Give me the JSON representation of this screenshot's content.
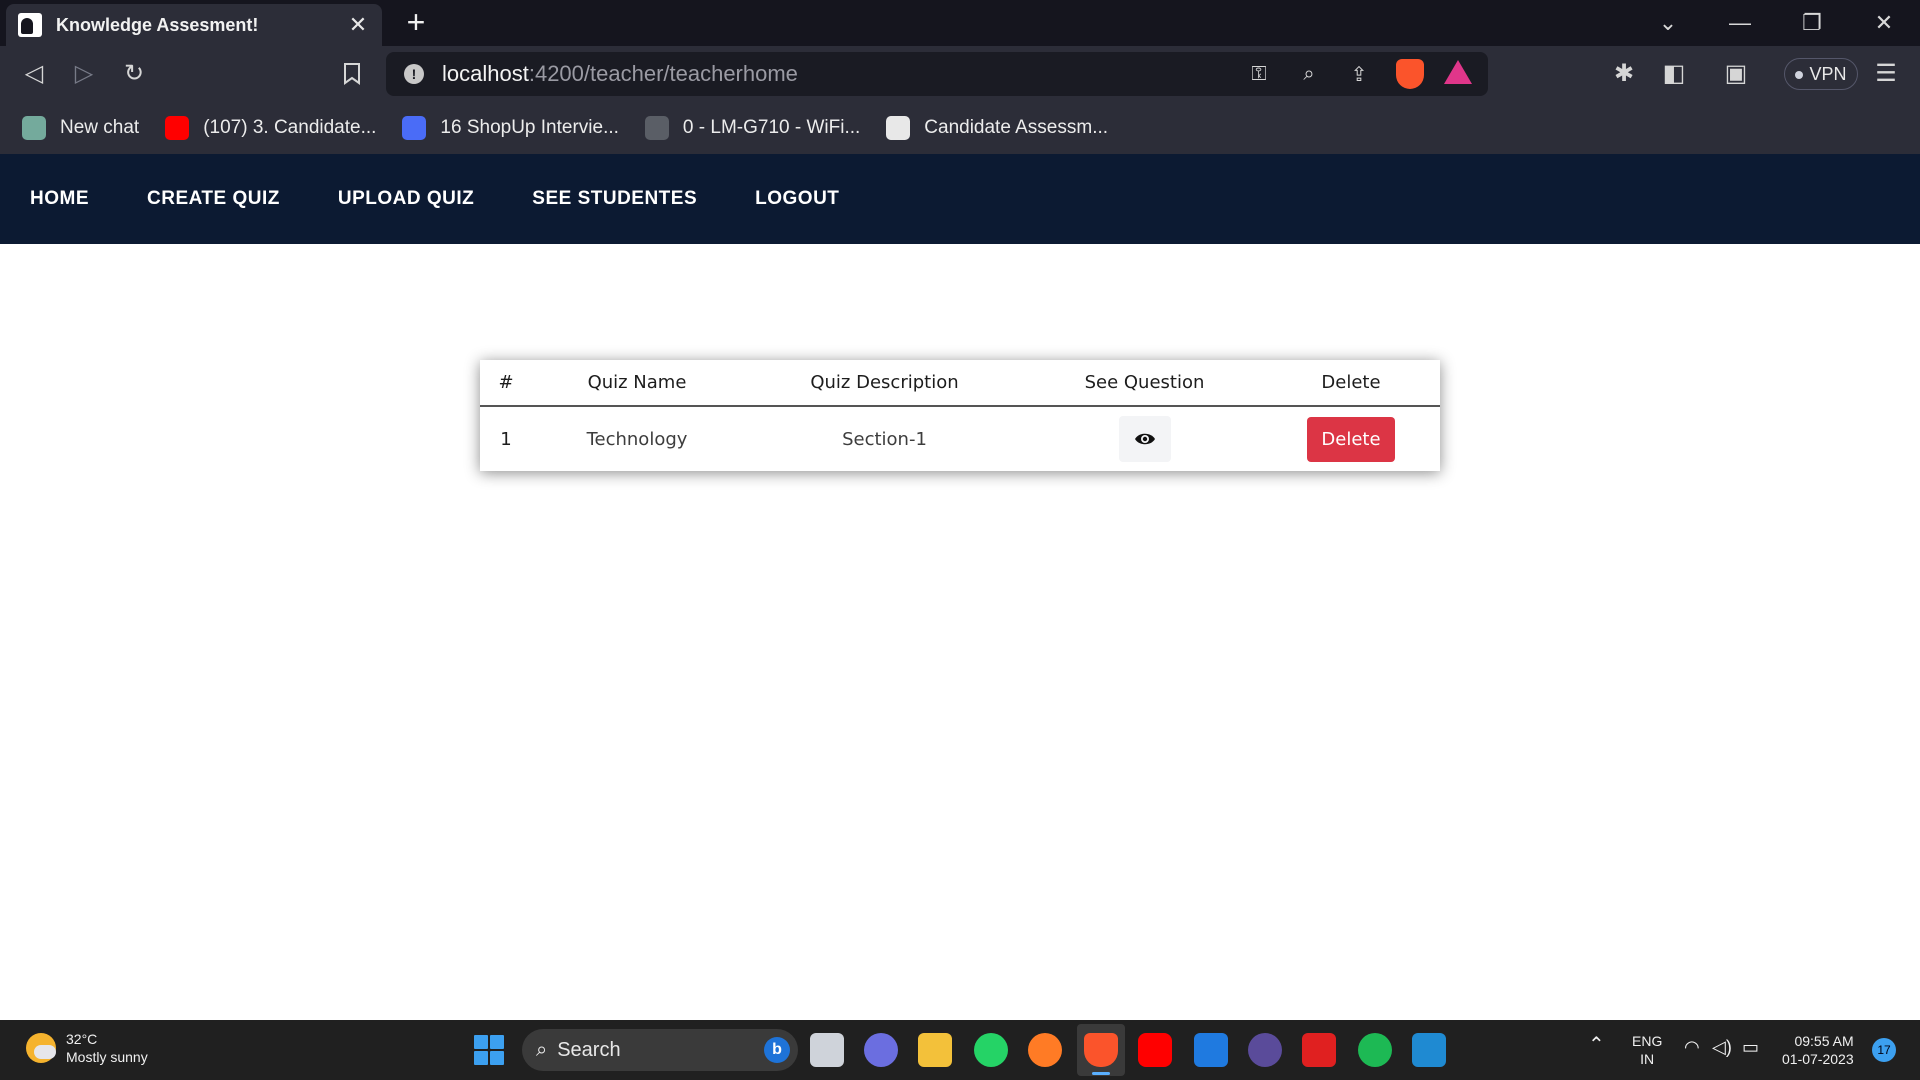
{
  "browser": {
    "tab_title": "Knowledge Assesment!",
    "tab_close": "✕",
    "new_tab": "+",
    "url_host": "localhost",
    "url_path": ":4200/teacher/teacherhome",
    "vpn_label": "VPN",
    "bookmarks": [
      {
        "label": "New chat",
        "icon": "chatgpt-icon",
        "color": "#74aa9c"
      },
      {
        "label": "(107) 3. Candidate...",
        "icon": "youtube-icon",
        "color": "#ff0000"
      },
      {
        "label": "16 ShopUp Intervie...",
        "icon": "cube-icon",
        "color": "#4a6cf7"
      },
      {
        "label": "0 - LM-G710 - WiFi...",
        "icon": "wifi-icon",
        "color": "#9aa0a6"
      },
      {
        "label": "Candidate Assessm...",
        "icon": "document-icon",
        "color": "#e8e8e8"
      }
    ]
  },
  "nav": {
    "links": [
      "HOME",
      "CREATE QUIZ",
      "UPLOAD QUIZ",
      "SEE STUDENTES",
      "LOGOUT"
    ]
  },
  "table": {
    "headers": [
      "#",
      "Quiz Name",
      "Quiz Description",
      "See Question",
      "Delete"
    ],
    "rows": [
      {
        "num": "1",
        "name": "Technology",
        "description": "Section-1",
        "delete_label": "Delete"
      }
    ]
  },
  "taskbar": {
    "temperature": "32°C",
    "weather": "Mostly sunny",
    "search_label": "Search",
    "lang_top": "ENG",
    "lang_bottom": "IN",
    "time": "09:55 AM",
    "date": "01-07-2023",
    "notifications": "17"
  },
  "colors": {
    "navbar": "#0c1a32",
    "delete_button": "#dc3545",
    "tab_bg": "#2c2d38"
  }
}
